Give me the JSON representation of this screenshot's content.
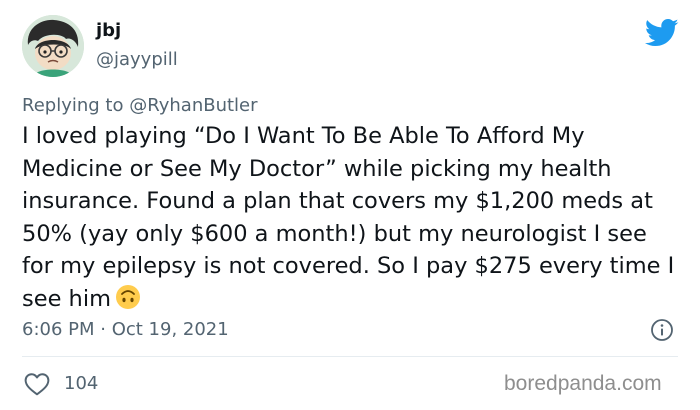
{
  "author": {
    "display_name": "jbj",
    "handle": "@jayypill"
  },
  "reply": {
    "prefix": "Replying to ",
    "mention": "@RyhanButler"
  },
  "tweet": {
    "text": "I loved playing “Do I Want To Be Able To Afford My Medicine or See My Doctor” while picking my health insurance. Found a plan that covers my $1,200 meds at 50% (yay only $600 a month!) but my neurologist I see for my epilepsy is not covered. So I pay $275 every time I see him",
    "emoji": "upside-down-face-emoji",
    "timestamp": "6:06 PM · Oct 19, 2021"
  },
  "actions": {
    "like_count": "104"
  },
  "icons": {
    "platform": "twitter-bird-icon",
    "info": "info-icon",
    "like": "heart-icon"
  },
  "colors": {
    "brand": "#1d9bf0",
    "text": "#0f1419",
    "muted": "#536471"
  },
  "watermark": "boredpanda.com"
}
